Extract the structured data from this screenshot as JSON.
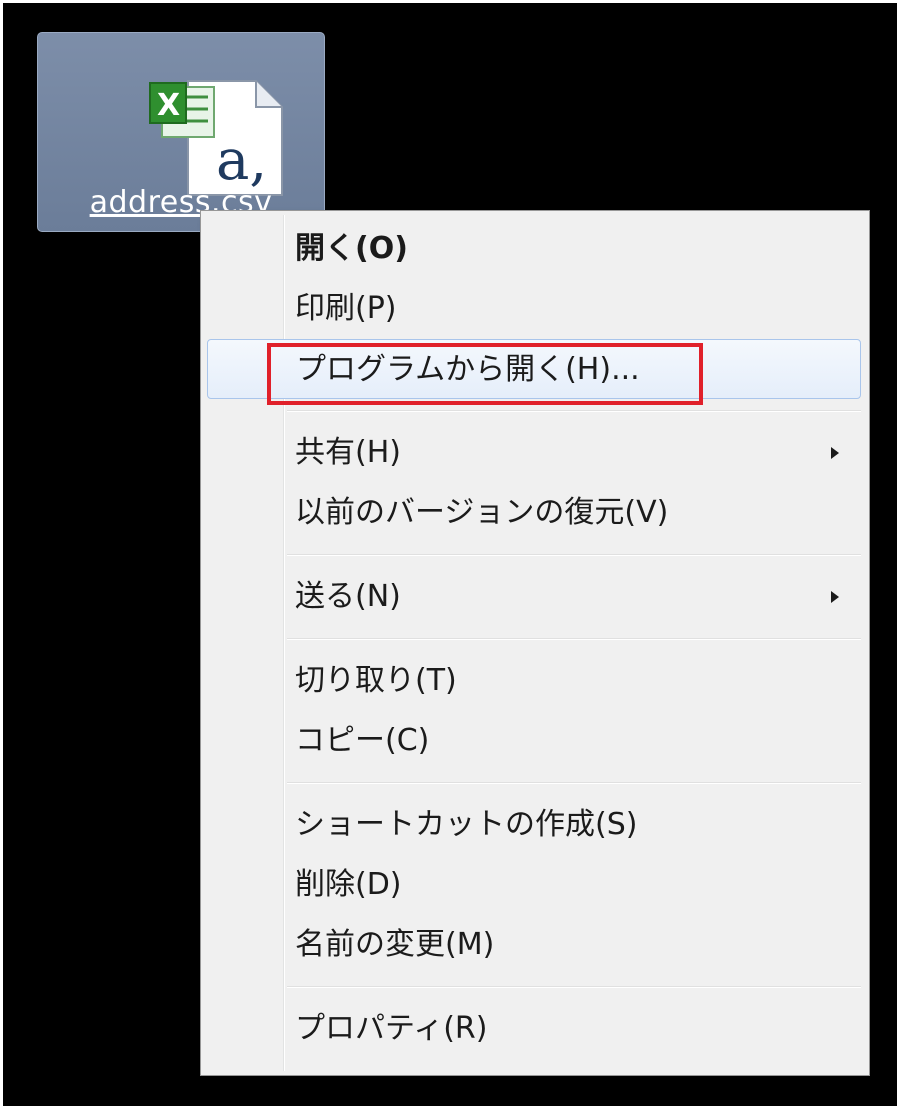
{
  "desktop": {
    "file": {
      "name": "address.csv",
      "icon": "excel-csv-file-icon",
      "badge_letter": "X",
      "doc_glyph": "a,"
    }
  },
  "context_menu": {
    "groups": [
      [
        {
          "label": "開く(O)",
          "bold": true
        },
        {
          "label": "印刷(P)"
        },
        {
          "label": "プログラムから開く(H)...",
          "highlighted": true
        }
      ],
      [
        {
          "label": "共有(H)",
          "submenu": true
        },
        {
          "label": "以前のバージョンの復元(V)"
        }
      ],
      [
        {
          "label": "送る(N)",
          "submenu": true
        }
      ],
      [
        {
          "label": "切り取り(T)"
        },
        {
          "label": "コピー(C)"
        }
      ],
      [
        {
          "label": "ショートカットの作成(S)"
        },
        {
          "label": "削除(D)"
        },
        {
          "label": "名前の変更(M)"
        }
      ],
      [
        {
          "label": "プロパティ(R)"
        }
      ]
    ],
    "callout_color": "#e0202a"
  }
}
